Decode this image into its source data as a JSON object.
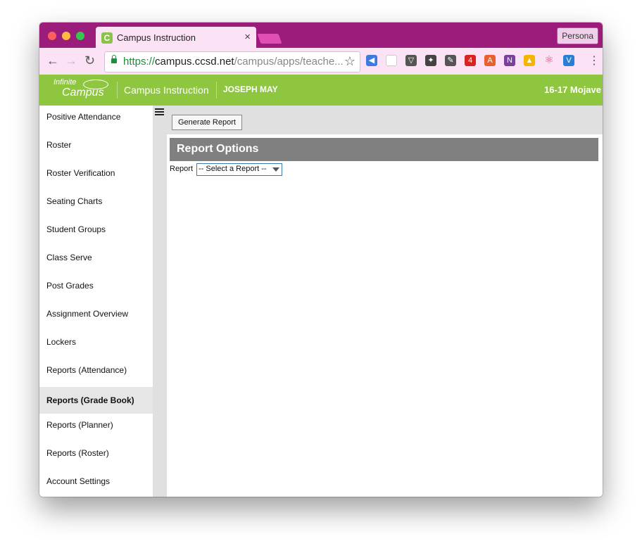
{
  "browser": {
    "tab_title": "Campus Instruction",
    "tab_favicon_letter": "C",
    "tab_close": "×",
    "profile_label": "Persona",
    "url_scheme": "https://",
    "url_host": "campus.ccsd.net",
    "url_path": "/campus/apps/teache...",
    "extension_badge": "4"
  },
  "header": {
    "logo_top": "Infinite",
    "logo_bottom": "Campus",
    "app_name": "Campus Instruction",
    "user_name": "JOSEPH MAY",
    "term": "16-17 Mojave"
  },
  "sidebar": {
    "items": [
      {
        "label": "Positive Attendance"
      },
      {
        "label": "Roster"
      },
      {
        "label": "Roster Verification"
      },
      {
        "label": "Seating Charts"
      },
      {
        "label": "Student Groups"
      },
      {
        "label": "Class Serve"
      },
      {
        "label": "Post Grades"
      },
      {
        "label": "Assignment Overview"
      },
      {
        "label": "Lockers"
      },
      {
        "label": "Reports (Attendance)"
      },
      {
        "label": "Reports (Grade Book)"
      },
      {
        "label": "Reports (Planner)"
      },
      {
        "label": "Reports (Roster)"
      },
      {
        "label": "Account Settings"
      }
    ],
    "active_item": "Reports (Grade Book)"
  },
  "main": {
    "generate_button": "Generate Report",
    "section_title": "Report Options",
    "report_label": "Report",
    "report_select_value": "-- Select a Report --"
  },
  "colors": {
    "tabstrip": "#9c1c7c",
    "header_green": "#8ec63f",
    "section_gray": "#808080"
  }
}
